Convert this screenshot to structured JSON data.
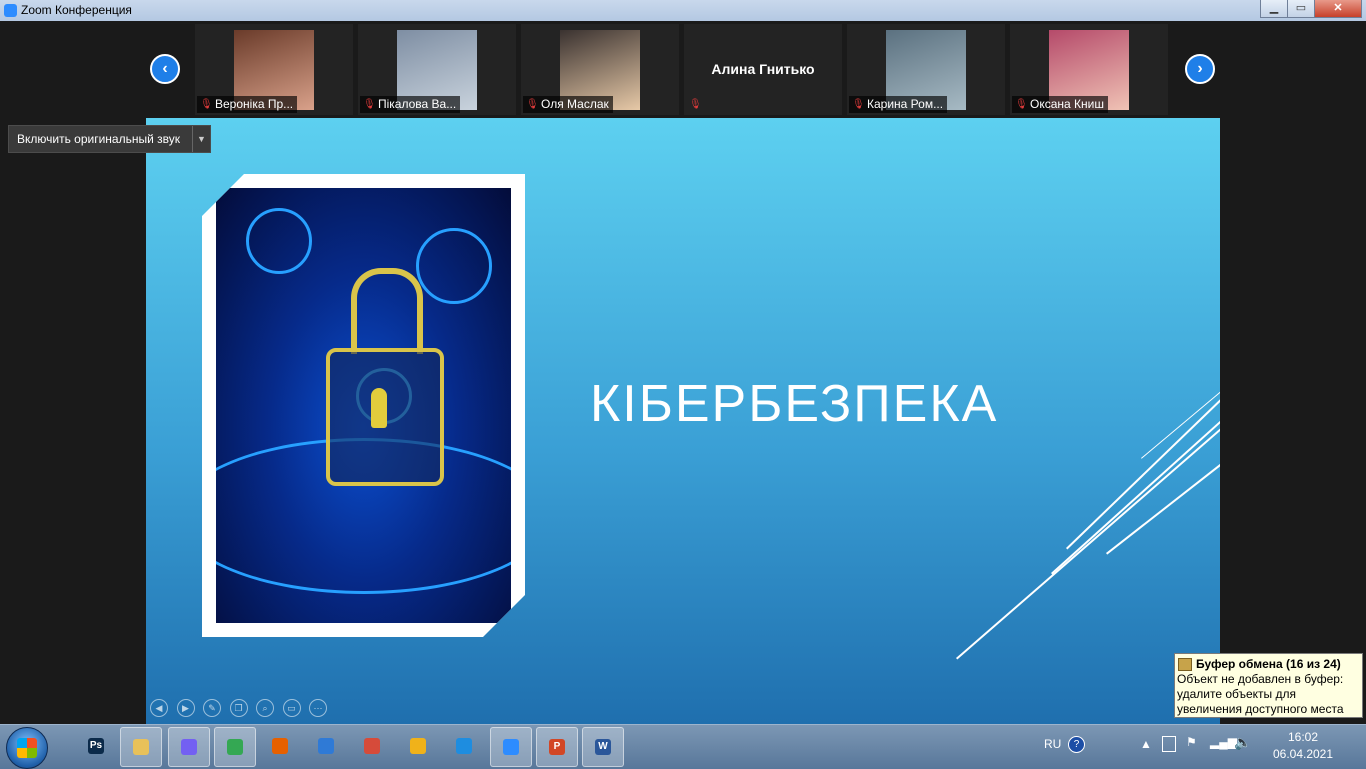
{
  "window": {
    "title": "Zoom Конференция"
  },
  "gallery": {
    "participants": [
      {
        "name": "Вероніка Пр...",
        "muted": true,
        "video": true,
        "photo_colors": [
          "#6a3b2a",
          "#d9a18a"
        ]
      },
      {
        "name": "Пікалова Ва...",
        "muted": true,
        "video": true,
        "photo_colors": [
          "#7e8ea3",
          "#c9d3dd"
        ]
      },
      {
        "name": "Оля Маслак",
        "muted": true,
        "video": true,
        "photo_colors": [
          "#3a3230",
          "#e7c9a7"
        ]
      },
      {
        "name": "",
        "big_name": "Алина Гнитько",
        "muted": true,
        "video": false
      },
      {
        "name": "Карина Ром...",
        "muted": true,
        "video": true,
        "photo_colors": [
          "#5b7180",
          "#a7bac4"
        ]
      },
      {
        "name": "Оксана Книш",
        "muted": true,
        "video": true,
        "photo_colors": [
          "#b54a6a",
          "#f0c3b5"
        ]
      }
    ]
  },
  "audio": {
    "original_sound_label": "Включить оригинальный звук"
  },
  "slide": {
    "title": "КІБЕРБЕЗПЕКА",
    "image_subject": "padlock-cybersecurity-image"
  },
  "slide_tools": [
    "prev-slide-icon",
    "next-slide-icon",
    "pen-icon",
    "copy-icon",
    "zoom-icon",
    "screen-icon",
    "more-icon"
  ],
  "taskbar": {
    "apps": [
      {
        "id": "photoshop",
        "label": "Ps",
        "color": "#0b2a4a"
      },
      {
        "id": "explorer",
        "label": "",
        "color": "#e8c15a",
        "pinned": true
      },
      {
        "id": "viber",
        "label": "",
        "color": "#7360f2",
        "pinned": true
      },
      {
        "id": "chrome",
        "label": "",
        "color": "#34a853",
        "pinned": true
      },
      {
        "id": "firefox",
        "label": "",
        "color": "#e66000"
      },
      {
        "id": "download",
        "label": "",
        "color": "#2f7ad6"
      },
      {
        "id": "presenter",
        "label": "",
        "color": "#d64b3a"
      },
      {
        "id": "media",
        "label": "",
        "color": "#f0b21a"
      },
      {
        "id": "app-blue",
        "label": "",
        "color": "#1e8de0"
      },
      {
        "id": "zoom",
        "label": "",
        "color": "#2d8cff",
        "active": true
      },
      {
        "id": "powerpoint",
        "label": "P",
        "color": "#d24726",
        "pinned": true
      },
      {
        "id": "word",
        "label": "W",
        "color": "#2b579a",
        "pinned": true
      }
    ],
    "language": "RU",
    "time": "16:02",
    "date": "06.04.2021"
  },
  "notification": {
    "title": "Буфер обмена (16 из 24)",
    "message": "Объект не добавлен в буфер: удалите объекты для увеличения доступного места"
  }
}
